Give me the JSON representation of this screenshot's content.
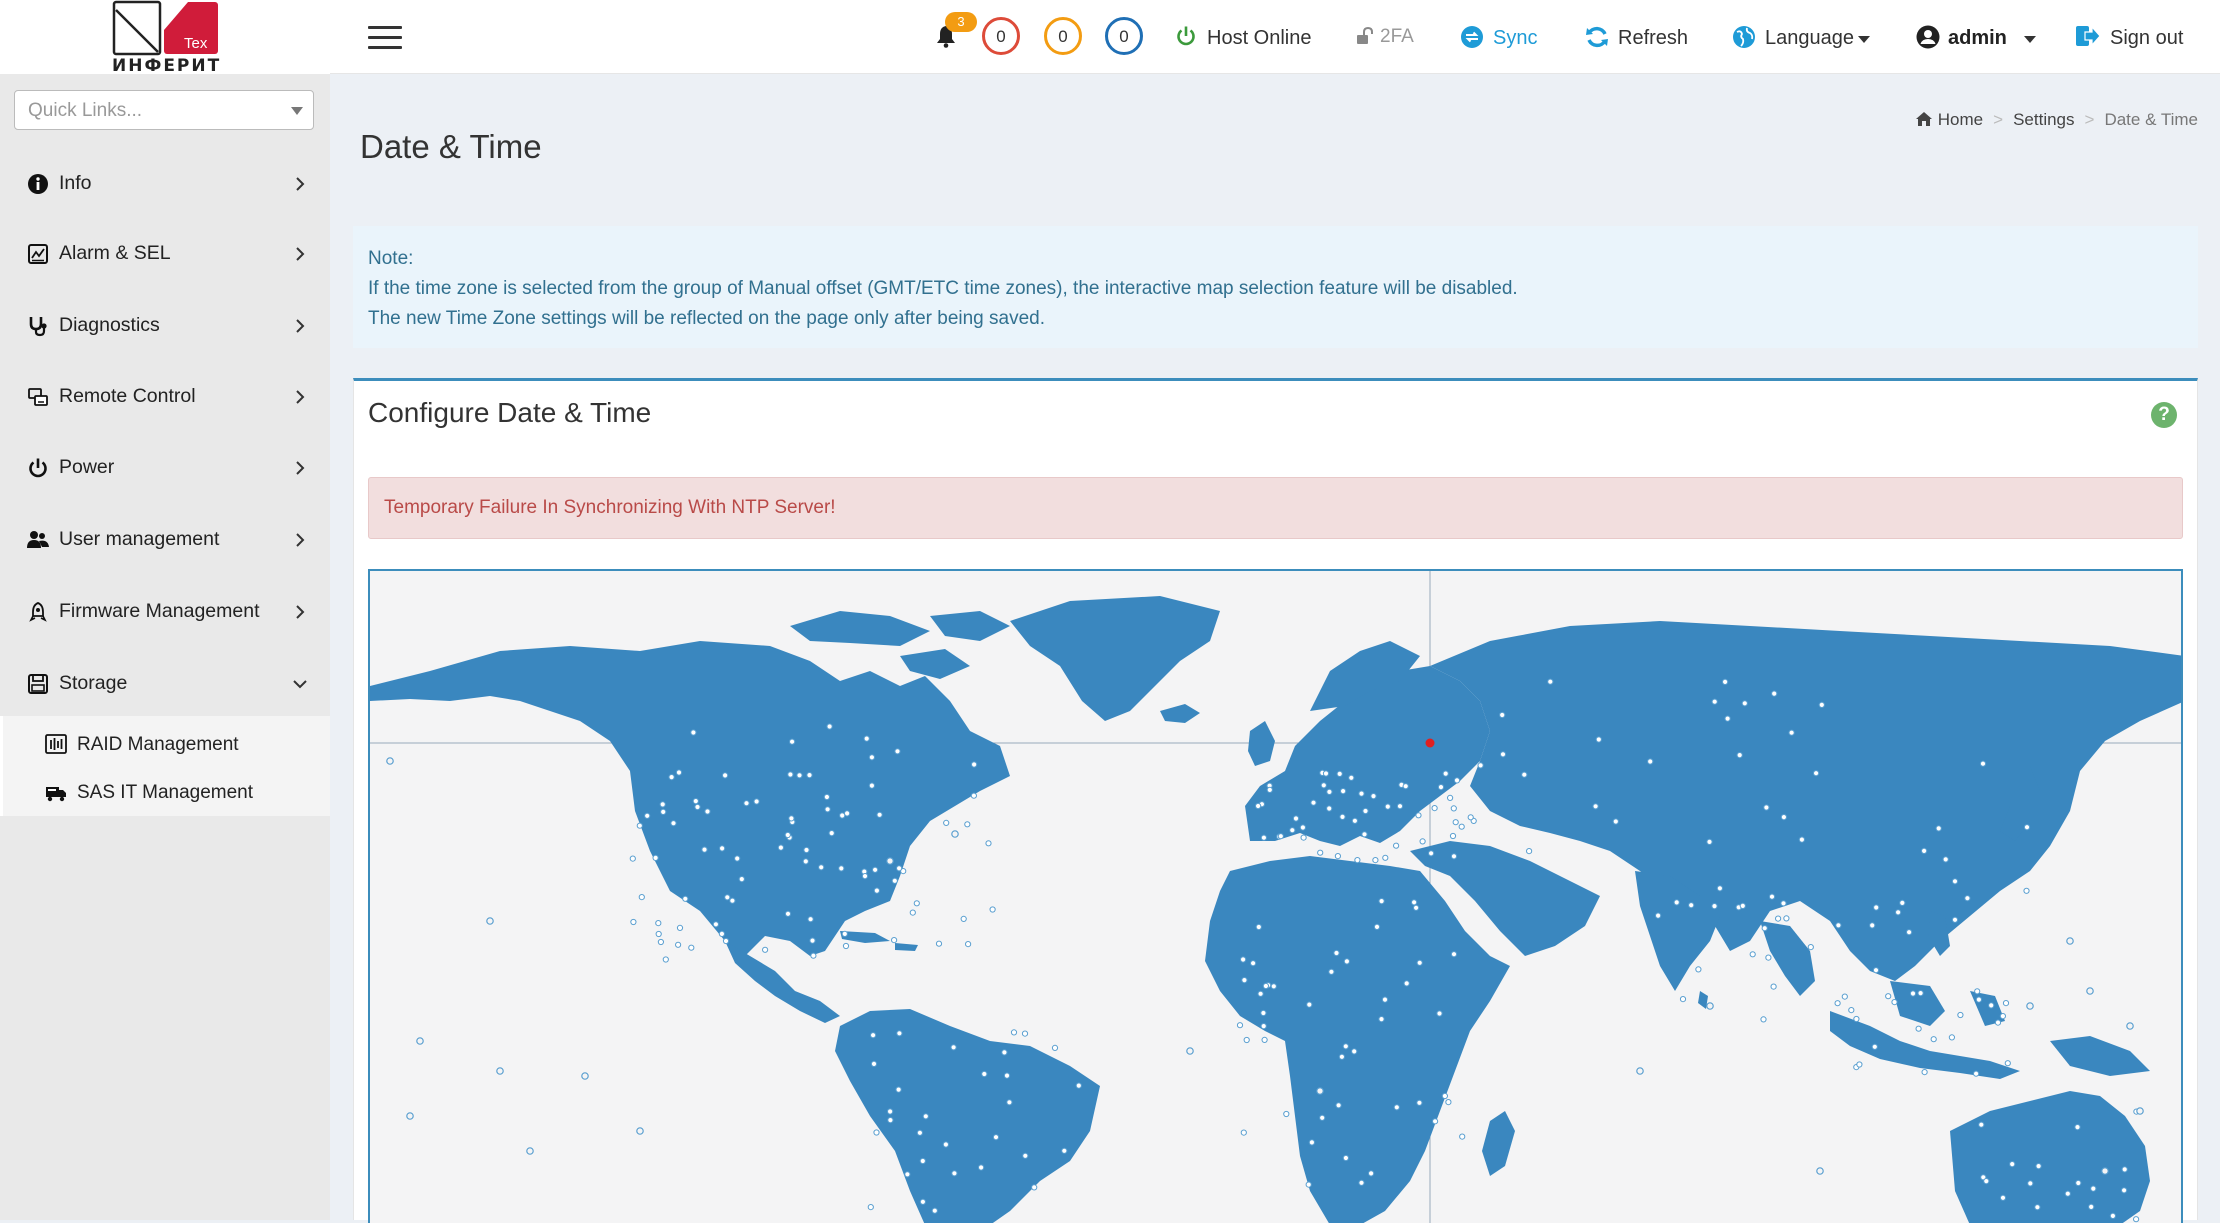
{
  "brand": {
    "logo_text": "ИНФЕРИТ",
    "logo_badge": "Tex",
    "accent_color": "#d01c3a"
  },
  "sidebar": {
    "quick_links_placeholder": "Quick Links...",
    "items": [
      {
        "label": "Info",
        "icon": "info-icon",
        "expanded": false
      },
      {
        "label": "Alarm & SEL",
        "icon": "alarm-icon",
        "expanded": false
      },
      {
        "label": "Diagnostics",
        "icon": "stethoscope-icon",
        "expanded": false
      },
      {
        "label": "Remote Control",
        "icon": "remote-control-icon",
        "expanded": false
      },
      {
        "label": "Power",
        "icon": "power-icon",
        "expanded": false
      },
      {
        "label": "User management",
        "icon": "users-icon",
        "expanded": false
      },
      {
        "label": "Firmware Management",
        "icon": "firmware-icon",
        "expanded": false
      },
      {
        "label": "Storage",
        "icon": "storage-icon",
        "expanded": true
      }
    ],
    "storage_subitems": [
      {
        "label": "RAID Management",
        "icon": "raid-icon"
      },
      {
        "label": "SAS IT Management",
        "icon": "sas-icon"
      }
    ]
  },
  "header": {
    "notification_count": "3",
    "status_counts": [
      {
        "value": "0",
        "color": "#dd4b39"
      },
      {
        "value": "0",
        "color": "#f39c12"
      },
      {
        "value": "0",
        "color": "#1f6fb5"
      }
    ],
    "host_status": "Host Online",
    "twofa_label": "2FA",
    "sync_label": "Sync",
    "refresh_label": "Refresh",
    "language_label": "Language",
    "user_label": "admin",
    "signout_label": "Sign out"
  },
  "page": {
    "title": "Date & Time",
    "breadcrumb": [
      "Home",
      "Settings",
      "Date & Time"
    ]
  },
  "note": {
    "heading": "Note:",
    "line1": "If the time zone is selected from the group of Manual offset (GMT/ETC time zones), the interactive map selection feature will be disabled.",
    "line2": "The new Time Zone settings will be reflected on the page only after being saved."
  },
  "configure": {
    "title": "Configure Date & Time",
    "alert": "Temporary Failure In Synchronizing With NTP Server!"
  }
}
